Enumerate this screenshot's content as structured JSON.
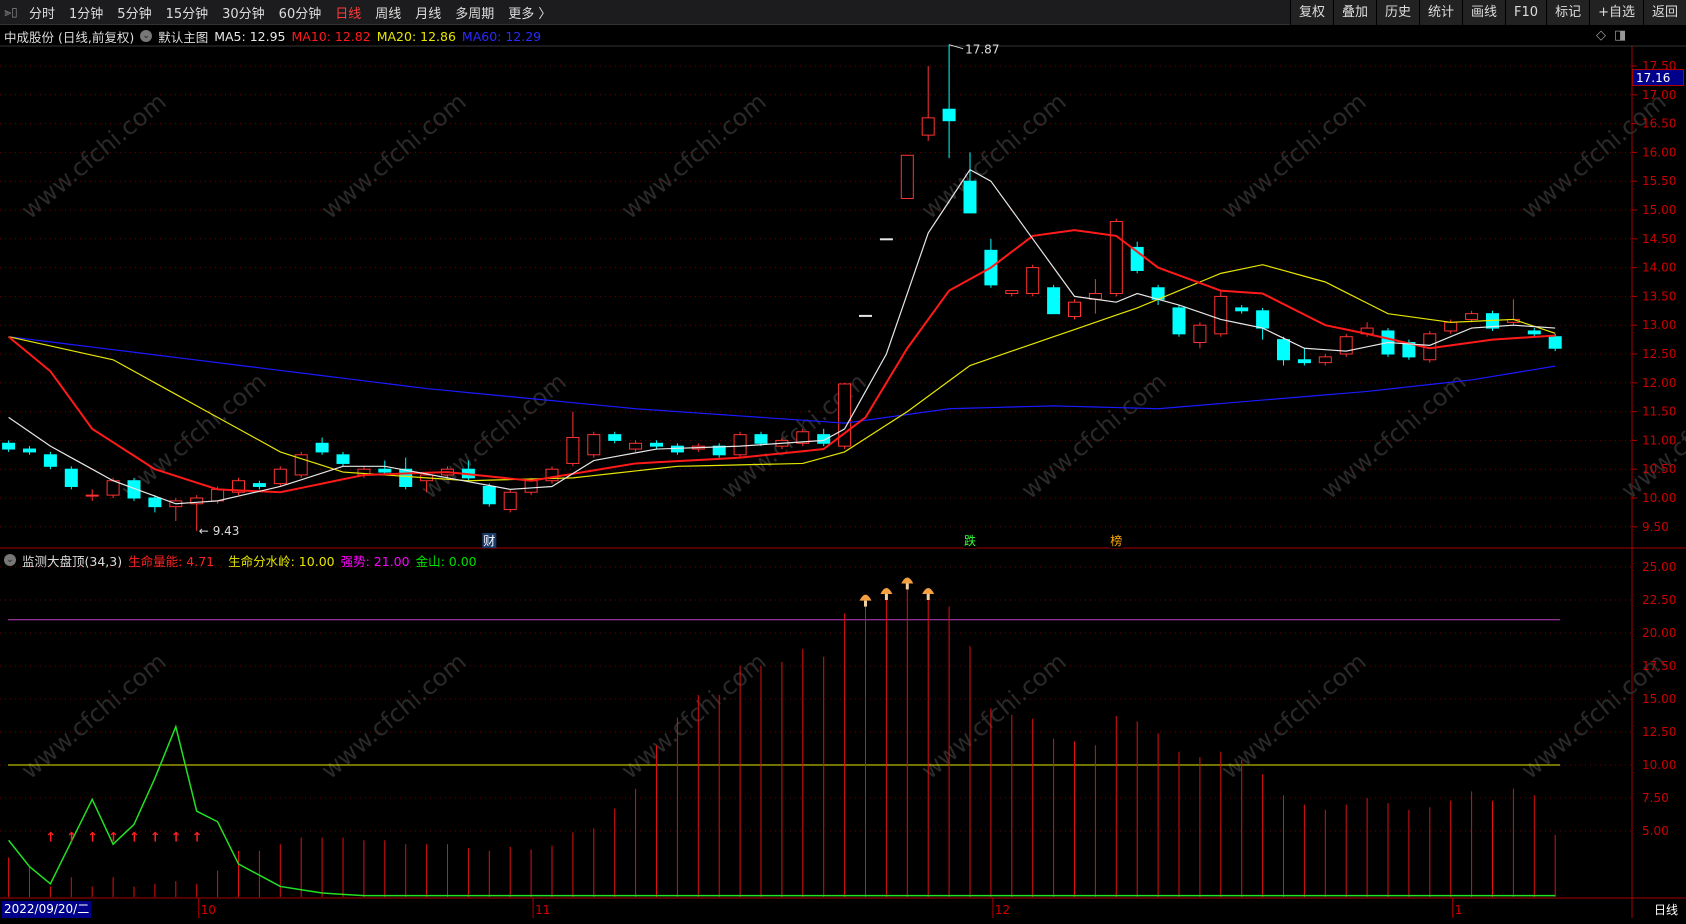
{
  "toolbar": {
    "periods": [
      "分时",
      "1分钟",
      "5分钟",
      "15分钟",
      "30分钟",
      "60分钟",
      "日线",
      "周线",
      "月线",
      "多周期",
      "更多 〉"
    ],
    "active": 6,
    "buttons": [
      "复权",
      "叠加",
      "历史",
      "统计",
      "画线",
      "F10",
      "标记",
      "+自选",
      "返回"
    ]
  },
  "info": {
    "stock": "中成股份 (日线,前复权)",
    "template": "默认主图",
    "ma5": "MA5: 12.95",
    "ma10": "MA10: 12.82",
    "ma20": "MA20: 12.86",
    "ma60": "MA60: 12.29"
  },
  "indicator": {
    "name": "监测大盘顶(34,3)",
    "energy": "生命量能: 4.71",
    "watershed": "生命分水岭: 10.00",
    "strength": "强势: 21.00",
    "gold": "金山: 0.00"
  },
  "colors": {
    "up": "#ff3232",
    "down": "#00ffff",
    "ma5": "#e6e6e6",
    "ma10": "#ff1a1a",
    "ma20": "#e6e600",
    "ma60": "#1a1aff",
    "grid": "#8b0000"
  },
  "current_price": "17.16",
  "xaxis": {
    "date": "2022/09/20/二",
    "period": "日线",
    "months": [
      {
        "label": "10",
        "index": 9
      },
      {
        "label": "11",
        "index": 25
      },
      {
        "label": "12",
        "index": 47
      },
      {
        "label": "1",
        "index": 69
      }
    ]
  },
  "chart_data": {
    "type": "candlestick",
    "price_ticks": [
      "17.50",
      "17.00",
      "16.50",
      "16.00",
      "15.50",
      "15.00",
      "14.50",
      "14.00",
      "13.50",
      "13.00",
      "12.50",
      "12.00",
      "11.50",
      "11.00",
      "10.50",
      "10.00",
      "9.50"
    ],
    "ind_ticks": [
      "25.00",
      "22.50",
      "20.00",
      "17.50",
      "15.00",
      "12.50",
      "10.00",
      "7.50",
      "5.00"
    ],
    "high_label": {
      "text": "17.87",
      "index": 45,
      "value": 17.87
    },
    "low_label": {
      "text": "9.43",
      "index": 9,
      "value": 9.43
    },
    "markers": [
      {
        "text": "财",
        "index": 23
      },
      {
        "text": "跌",
        "index": 46
      },
      {
        "text": "榜",
        "index": 53
      }
    ],
    "ohlc": [
      [
        10.95,
        11.0,
        10.8,
        10.85
      ],
      [
        10.85,
        10.9,
        10.75,
        10.8
      ],
      [
        10.75,
        10.8,
        10.5,
        10.55
      ],
      [
        10.5,
        10.55,
        10.15,
        10.2
      ],
      [
        10.05,
        10.15,
        9.95,
        10.05
      ],
      [
        10.05,
        10.35,
        10.0,
        10.3
      ],
      [
        10.3,
        10.35,
        9.95,
        10.0
      ],
      [
        10.0,
        10.05,
        9.75,
        9.85
      ],
      [
        9.85,
        10.0,
        9.6,
        9.95
      ],
      [
        9.9,
        10.05,
        9.43,
        10.0
      ],
      [
        9.95,
        10.2,
        9.9,
        10.15
      ],
      [
        10.1,
        10.35,
        10.05,
        10.3
      ],
      [
        10.25,
        10.3,
        10.15,
        10.2
      ],
      [
        10.25,
        10.55,
        10.2,
        10.5
      ],
      [
        10.4,
        10.8,
        10.35,
        10.75
      ],
      [
        10.95,
        11.05,
        10.75,
        10.8
      ],
      [
        10.75,
        10.8,
        10.55,
        10.6
      ],
      [
        10.4,
        10.55,
        10.35,
        10.5
      ],
      [
        10.5,
        10.65,
        10.4,
        10.45
      ],
      [
        10.5,
        10.7,
        10.15,
        10.2
      ],
      [
        10.3,
        10.45,
        10.1,
        10.4
      ],
      [
        10.4,
        10.55,
        10.35,
        10.5
      ],
      [
        10.5,
        10.65,
        10.3,
        10.35
      ],
      [
        10.2,
        10.25,
        9.85,
        9.9
      ],
      [
        9.8,
        10.15,
        9.75,
        10.1
      ],
      [
        10.1,
        10.35,
        10.05,
        10.3
      ],
      [
        10.3,
        10.55,
        10.25,
        10.5
      ],
      [
        10.6,
        11.5,
        10.55,
        11.05
      ],
      [
        10.75,
        11.15,
        10.7,
        11.1
      ],
      [
        11.1,
        11.15,
        10.95,
        11.0
      ],
      [
        10.85,
        11.0,
        10.8,
        10.95
      ],
      [
        10.95,
        11.0,
        10.85,
        10.9
      ],
      [
        10.9,
        10.95,
        10.75,
        10.8
      ],
      [
        10.85,
        10.95,
        10.8,
        10.9
      ],
      [
        10.9,
        10.95,
        10.7,
        10.75
      ],
      [
        10.75,
        11.15,
        10.7,
        11.1
      ],
      [
        11.1,
        11.15,
        10.9,
        10.95
      ],
      [
        10.9,
        11.05,
        10.85,
        11.0
      ],
      [
        10.95,
        11.2,
        10.9,
        11.15
      ],
      [
        11.1,
        11.2,
        10.9,
        10.95
      ],
      [
        10.9,
        12.0,
        10.85,
        11.98
      ],
      [
        13.17,
        13.17,
        13.17,
        13.17
      ],
      [
        14.5,
        14.5,
        14.5,
        14.5
      ],
      [
        15.2,
        15.95,
        15.2,
        15.95
      ],
      [
        16.3,
        17.5,
        16.2,
        16.6
      ],
      [
        16.75,
        17.87,
        15.9,
        16.55
      ],
      [
        15.5,
        16.0,
        14.95,
        14.95
      ],
      [
        14.3,
        14.5,
        13.65,
        13.7
      ],
      [
        13.55,
        13.6,
        13.5,
        13.6
      ],
      [
        13.55,
        14.05,
        13.5,
        14.0
      ],
      [
        13.65,
        13.7,
        13.2,
        13.2
      ],
      [
        13.15,
        13.45,
        13.1,
        13.4
      ],
      [
        13.45,
        13.8,
        13.2,
        13.55
      ],
      [
        13.55,
        14.85,
        13.5,
        14.8
      ],
      [
        14.35,
        14.45,
        13.9,
        13.95
      ],
      [
        13.65,
        13.7,
        13.35,
        13.45
      ],
      [
        13.3,
        13.35,
        12.8,
        12.85
      ],
      [
        12.7,
        13.05,
        12.6,
        13.0
      ],
      [
        12.85,
        13.6,
        12.8,
        13.5
      ],
      [
        13.3,
        13.35,
        13.2,
        13.25
      ],
      [
        13.25,
        13.3,
        12.75,
        12.95
      ],
      [
        12.75,
        12.8,
        12.3,
        12.4
      ],
      [
        12.4,
        12.6,
        12.3,
        12.35
      ],
      [
        12.35,
        12.5,
        12.3,
        12.45
      ],
      [
        12.5,
        12.85,
        12.45,
        12.8
      ],
      [
        12.85,
        13.05,
        12.8,
        12.95
      ],
      [
        12.9,
        12.95,
        12.45,
        12.5
      ],
      [
        12.7,
        12.75,
        12.4,
        12.45
      ],
      [
        12.4,
        12.9,
        12.35,
        12.85
      ],
      [
        12.9,
        13.1,
        12.85,
        13.05
      ],
      [
        13.1,
        13.25,
        13.05,
        13.2
      ],
      [
        13.2,
        13.25,
        12.9,
        12.95
      ],
      [
        13.05,
        13.45,
        13.0,
        13.1
      ],
      [
        12.9,
        12.95,
        12.8,
        12.85
      ],
      [
        12.8,
        12.85,
        12.55,
        12.6
      ]
    ],
    "ma_keyframes": {
      "ma60": [
        [
          0,
          12.8
        ],
        [
          20,
          11.9
        ],
        [
          30,
          11.55
        ],
        [
          40,
          11.3
        ],
        [
          45,
          11.55
        ],
        [
          50,
          11.6
        ],
        [
          55,
          11.55
        ],
        [
          60,
          11.7
        ],
        [
          65,
          11.85
        ],
        [
          70,
          12.05
        ],
        [
          74,
          12.29
        ]
      ],
      "ma20": [
        [
          0,
          12.8
        ],
        [
          5,
          12.4
        ],
        [
          10,
          11.4
        ],
        [
          13,
          10.8
        ],
        [
          16,
          10.45
        ],
        [
          22,
          10.3
        ],
        [
          27,
          10.35
        ],
        [
          32,
          10.55
        ],
        [
          38,
          10.6
        ],
        [
          40,
          10.8
        ],
        [
          43,
          11.5
        ],
        [
          46,
          12.3
        ],
        [
          50,
          12.8
        ],
        [
          54,
          13.3
        ],
        [
          58,
          13.9
        ],
        [
          60,
          14.05
        ],
        [
          63,
          13.75
        ],
        [
          66,
          13.2
        ],
        [
          69,
          13.05
        ],
        [
          72,
          13.1
        ],
        [
          74,
          12.86
        ]
      ],
      "ma10": [
        [
          0,
          12.8
        ],
        [
          2,
          12.2
        ],
        [
          4,
          11.2
        ],
        [
          7,
          10.5
        ],
        [
          10,
          10.15
        ],
        [
          13,
          10.1
        ],
        [
          17,
          10.4
        ],
        [
          21,
          10.45
        ],
        [
          25,
          10.3
        ],
        [
          30,
          10.6
        ],
        [
          35,
          10.7
        ],
        [
          39,
          10.85
        ],
        [
          41,
          11.4
        ],
        [
          43,
          12.6
        ],
        [
          45,
          13.6
        ],
        [
          47,
          14.0
        ],
        [
          49,
          14.55
        ],
        [
          51,
          14.65
        ],
        [
          53,
          14.55
        ],
        [
          55,
          14.0
        ],
        [
          58,
          13.6
        ],
        [
          60,
          13.55
        ],
        [
          63,
          13.0
        ],
        [
          65,
          12.85
        ],
        [
          68,
          12.6
        ],
        [
          71,
          12.75
        ],
        [
          74,
          12.82
        ]
      ],
      "ma5": [
        [
          0,
          11.4
        ],
        [
          2,
          10.9
        ],
        [
          5,
          10.3
        ],
        [
          8,
          9.9
        ],
        [
          10,
          9.95
        ],
        [
          13,
          10.2
        ],
        [
          16,
          10.55
        ],
        [
          18,
          10.55
        ],
        [
          21,
          10.35
        ],
        [
          24,
          10.15
        ],
        [
          26,
          10.2
        ],
        [
          28,
          10.65
        ],
        [
          31,
          10.85
        ],
        [
          35,
          10.9
        ],
        [
          39,
          11.0
        ],
        [
          40,
          11.2
        ],
        [
          42,
          12.5
        ],
        [
          44,
          14.6
        ],
        [
          46,
          15.7
        ],
        [
          47,
          15.5
        ],
        [
          49,
          14.5
        ],
        [
          51,
          13.5
        ],
        [
          53,
          13.4
        ],
        [
          54,
          13.55
        ],
        [
          56,
          13.35
        ],
        [
          58,
          13.1
        ],
        [
          60,
          12.95
        ],
        [
          62,
          12.6
        ],
        [
          64,
          12.55
        ],
        [
          66,
          12.7
        ],
        [
          68,
          12.65
        ],
        [
          70,
          12.95
        ],
        [
          72,
          13.0
        ],
        [
          74,
          12.95
        ]
      ]
    },
    "energy_bars": [
      3.0,
      2.3,
      0.8,
      1.5,
      0.8,
      1.5,
      0.8,
      1.0,
      1.2,
      1.0,
      2.0,
      3.5,
      3.5,
      4.0,
      4.5,
      4.5,
      4.5,
      4.3,
      4.3,
      4.0,
      4.0,
      4.0,
      3.7,
      3.5,
      3.8,
      3.6,
      3.9,
      4.9,
      5.2,
      6.7,
      8.2,
      11.5,
      13.6,
      15.3,
      15.3,
      17.5,
      17.5,
      17.8,
      18.8,
      18.2,
      21.5,
      22.0,
      22.5,
      23.3,
      22.5,
      22.0,
      19.0,
      14.3,
      13.8,
      13.5,
      12.0,
      11.8,
      11.5,
      13.7,
      13.3,
      12.4,
      11.0,
      10.6,
      11.0,
      10.4,
      9.3,
      7.7,
      7.0,
      6.6,
      7.0,
      7.5,
      7.1,
      6.6,
      6.8,
      7.3,
      8.0,
      7.3,
      8.2,
      7.7,
      4.71
    ],
    "gold_line": [
      [
        0,
        4.3
      ],
      [
        1,
        2.3
      ],
      [
        2,
        1.0
      ],
      [
        4,
        7.4
      ],
      [
        5,
        4.0
      ],
      [
        6,
        5.5
      ],
      [
        7,
        9.0
      ],
      [
        8,
        12.9
      ],
      [
        9,
        6.5
      ],
      [
        10,
        5.7
      ],
      [
        11,
        2.5
      ],
      [
        13,
        0.8
      ],
      [
        15,
        0.3
      ],
      [
        17,
        0.1
      ],
      [
        74,
        0.1
      ]
    ],
    "strength_level": 21.0,
    "watershed_level": 10.0,
    "up_arrows": [
      2,
      3,
      4,
      5,
      6,
      7,
      8,
      9
    ],
    "top_signals": [
      41,
      42,
      43,
      44
    ]
  }
}
